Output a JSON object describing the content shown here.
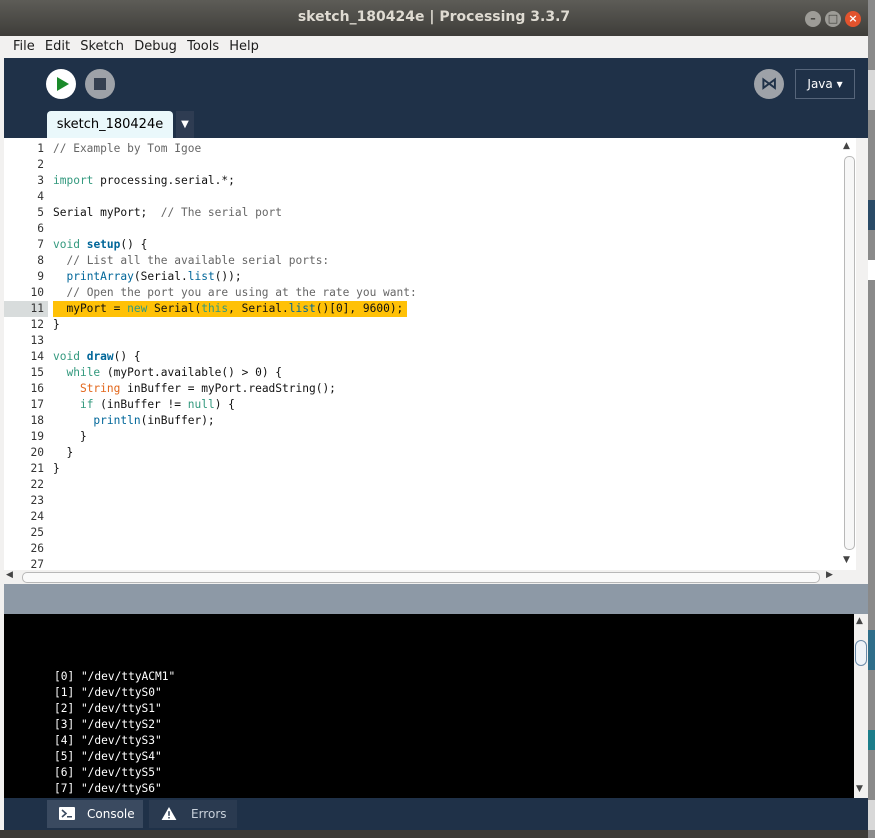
{
  "window": {
    "title": "sketch_180424e | Processing 3.3.7"
  },
  "menu": [
    "File",
    "Edit",
    "Sketch",
    "Debug",
    "Tools",
    "Help"
  ],
  "toolbar": {
    "mode_label": "Java ▾"
  },
  "tab": {
    "name": "sketch_180424e",
    "menu_glyph": "▼"
  },
  "editor": {
    "current_line": 11,
    "line_numbers": [
      "1",
      "2",
      "3",
      "4",
      "5",
      "6",
      "7",
      "8",
      "9",
      "10",
      "11",
      "12",
      "13",
      "14",
      "15",
      "16",
      "17",
      "18",
      "19",
      "20",
      "21",
      "22",
      "23",
      "24",
      "25",
      "26",
      "27"
    ]
  },
  "console": {
    "lines": [
      "[0] \"/dev/ttyACM1\"",
      "[1] \"/dev/ttyS0\"",
      "[2] \"/dev/ttyS1\"",
      "[3] \"/dev/ttyS2\"",
      "[4] \"/dev/ttyS3\"",
      "[5] \"/dev/ttyS4\"",
      "[6] \"/dev/ttyS5\"",
      "[7] \"/dev/ttyS6\""
    ]
  },
  "footer": {
    "console_label": "Console",
    "errors_label": "Errors"
  },
  "colors": {
    "toolbar_bg": "#1f3148",
    "highlight": "#ffc107",
    "run_green": "#1a8a2a",
    "console_bg": "#000000"
  }
}
